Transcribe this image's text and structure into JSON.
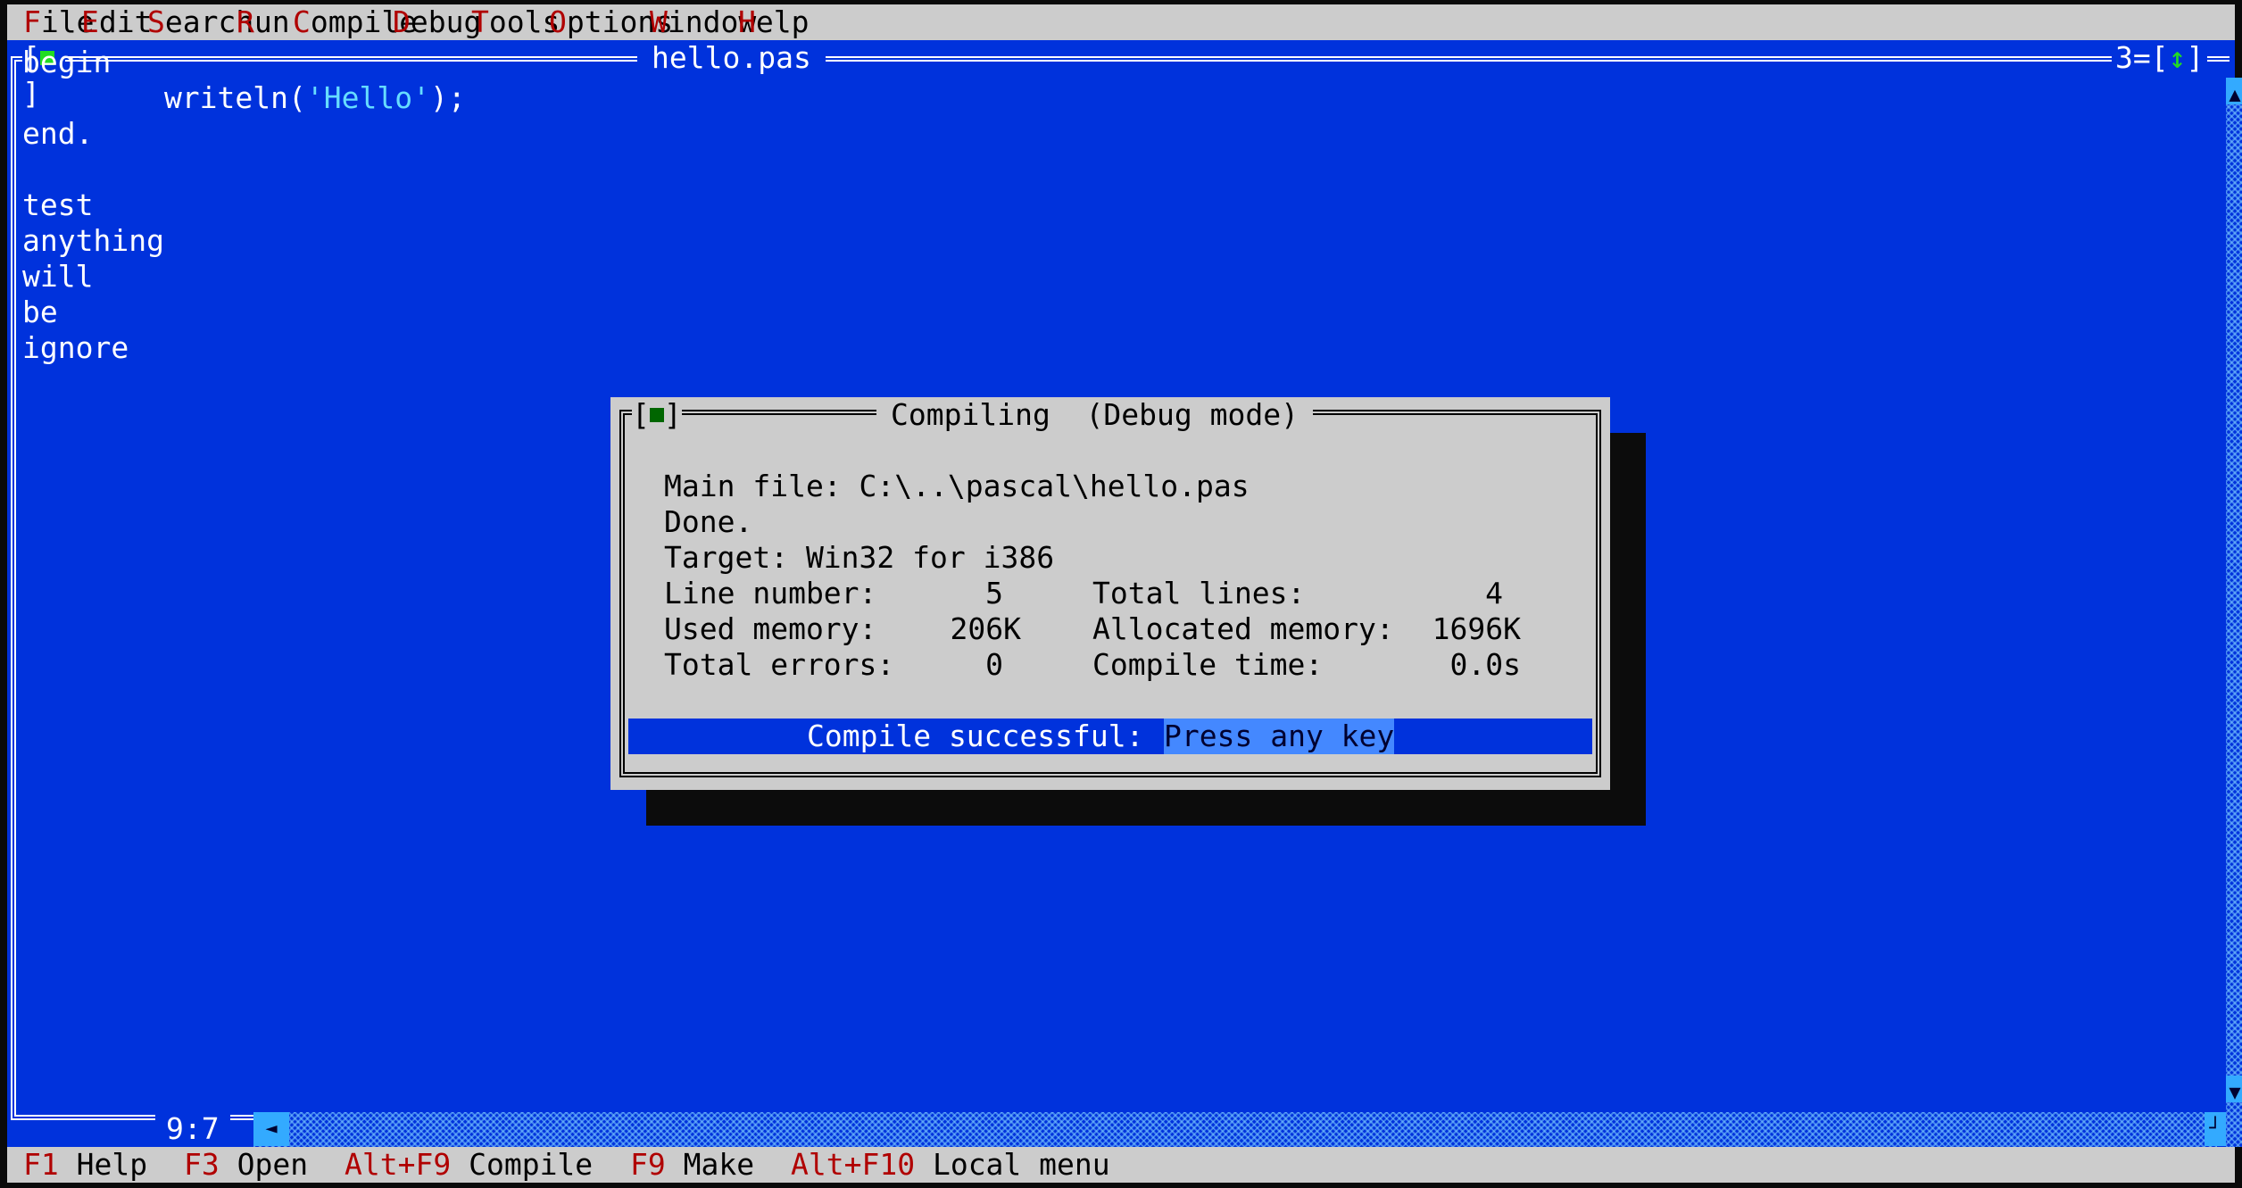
{
  "menu": [
    {
      "hot": "F",
      "rest": "ile"
    },
    {
      "hot": "E",
      "rest": "dit"
    },
    {
      "hot": "S",
      "rest": "earch"
    },
    {
      "hot": "R",
      "rest": "un"
    },
    {
      "hot": "C",
      "rest": "ompile"
    },
    {
      "hot": "D",
      "rest": "ebug"
    },
    {
      "hot": "T",
      "rest": "ools"
    },
    {
      "hot": "O",
      "rest": "ptions"
    },
    {
      "hot": "W",
      "rest": "indow"
    },
    {
      "hot": "H",
      "rest": "elp"
    }
  ],
  "editor": {
    "title": "hello.pas",
    "window_number": "3",
    "cursor_position": "9:7",
    "code": {
      "l1": "begin",
      "l2a": "        writeln(",
      "l2_string": "'Hello'",
      "l2b": ");",
      "l3": "end.",
      "l4": "",
      "l5": "test",
      "l6": "anything",
      "l7": "will",
      "l8": "be",
      "l9": "ignore"
    }
  },
  "dialog": {
    "title": "Compiling  (Debug mode)",
    "main_file": "Main file: C:\\..\\pascal\\hello.pas",
    "status": "Done.",
    "target": "Target: Win32 for i386",
    "line_number_label": "Line number:",
    "line_number_value": "5",
    "total_lines_label": "Total lines:",
    "total_lines_value": "4",
    "used_memory_label": "Used memory:",
    "used_memory_value": "206K",
    "allocated_memory_label": "Allocated memory:",
    "allocated_memory_value": "1696K",
    "total_errors_label": "Total errors:",
    "total_errors_value": "0",
    "compile_time_label": "Compile time:",
    "compile_time_value": "0.0s",
    "result_label": "Compile successful:",
    "result_prompt": "Press any key"
  },
  "statusline": [
    {
      "key": "F1",
      "label": "Help"
    },
    {
      "key": "F3",
      "label": "Open"
    },
    {
      "key": "Alt+F9",
      "label": "Compile"
    },
    {
      "key": "F9",
      "label": "Make"
    },
    {
      "key": "Alt+F10",
      "label": "Local menu"
    }
  ],
  "colors": {
    "desktop_blue": "#0032dc",
    "menu_gray": "#cccccc",
    "hotkey_red": "#b00000",
    "string_cyan": "#66ddff",
    "highlight": "#4488ff"
  }
}
